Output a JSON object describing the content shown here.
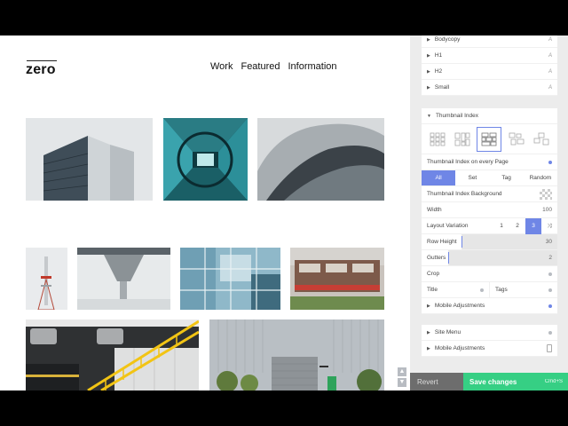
{
  "site": {
    "logo": "zero",
    "nav": [
      "Work",
      "Featured",
      "Information"
    ]
  },
  "panel": {
    "text_styles": [
      "Bodycopy",
      "H1",
      "H2",
      "Small"
    ],
    "text_style_icon": "A",
    "thumbnail_index": {
      "title": "Thumbnail Index",
      "on_every_page_label": "Thumbnail Index on every Page",
      "filter_tabs": [
        "All",
        "Set",
        "Tag",
        "Random"
      ],
      "filter_selected": "All",
      "background_label": "Thumbnail Index Background",
      "width_label": "Width",
      "width_value": "100",
      "layout_variation_label": "Layout Variation",
      "layout_variations": [
        "1",
        "2",
        "3"
      ],
      "layout_variation_selected": "3",
      "shuffle_icon": "⤨",
      "row_height_label": "Row Height",
      "row_height_value": "30",
      "gutters_label": "Gutters",
      "gutters_value": "2",
      "crop_label": "Crop",
      "title_label": "Title",
      "tags_label": "Tags",
      "mobile_label": "Mobile Adjustments"
    },
    "site_menu": {
      "site_menu_label": "Site Menu",
      "mobile_label": "Mobile Adjustments"
    }
  },
  "footer": {
    "revert_label": "Revert",
    "save_label": "Save changes",
    "save_shortcut": "Cmd+S"
  },
  "colors": {
    "accent": "#6f86e6",
    "save": "#36cf84",
    "revert": "#6d6d6d",
    "panel_bg": "#ececec"
  }
}
